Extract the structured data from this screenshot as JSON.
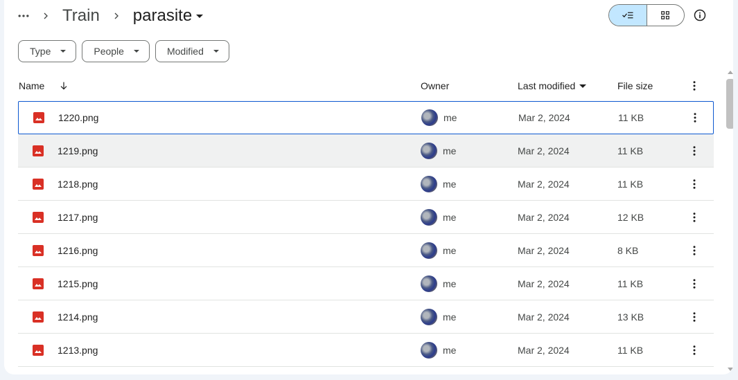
{
  "breadcrumb": {
    "more_icon": "more-horiz-icon",
    "items": [
      "Train",
      "parasite"
    ]
  },
  "view_toggle": {
    "active": "list",
    "list_icon": "check-list-icon",
    "grid_icon": "grid-icon"
  },
  "info_icon": "info-icon",
  "filters": [
    {
      "label": "Type"
    },
    {
      "label": "People"
    },
    {
      "label": "Modified"
    }
  ],
  "columns": {
    "name": "Name",
    "owner": "Owner",
    "last_modified": "Last modified",
    "file_size": "File size"
  },
  "files": [
    {
      "name": "1220.png",
      "owner": "me",
      "modified": "Mar 2, 2024",
      "size": "11 KB"
    },
    {
      "name": "1219.png",
      "owner": "me",
      "modified": "Mar 2, 2024",
      "size": "11 KB"
    },
    {
      "name": "1218.png",
      "owner": "me",
      "modified": "Mar 2, 2024",
      "size": "11 KB"
    },
    {
      "name": "1217.png",
      "owner": "me",
      "modified": "Mar 2, 2024",
      "size": "12 KB"
    },
    {
      "name": "1216.png",
      "owner": "me",
      "modified": "Mar 2, 2024",
      "size": "8 KB"
    },
    {
      "name": "1215.png",
      "owner": "me",
      "modified": "Mar 2, 2024",
      "size": "11 KB"
    },
    {
      "name": "1214.png",
      "owner": "me",
      "modified": "Mar 2, 2024",
      "size": "13 KB"
    },
    {
      "name": "1213.png",
      "owner": "me",
      "modified": "Mar 2, 2024",
      "size": "11 KB"
    }
  ],
  "colors": {
    "image_icon": "#d93025",
    "selection": "#0b57d0",
    "toggle_active": "#c2e7ff"
  }
}
